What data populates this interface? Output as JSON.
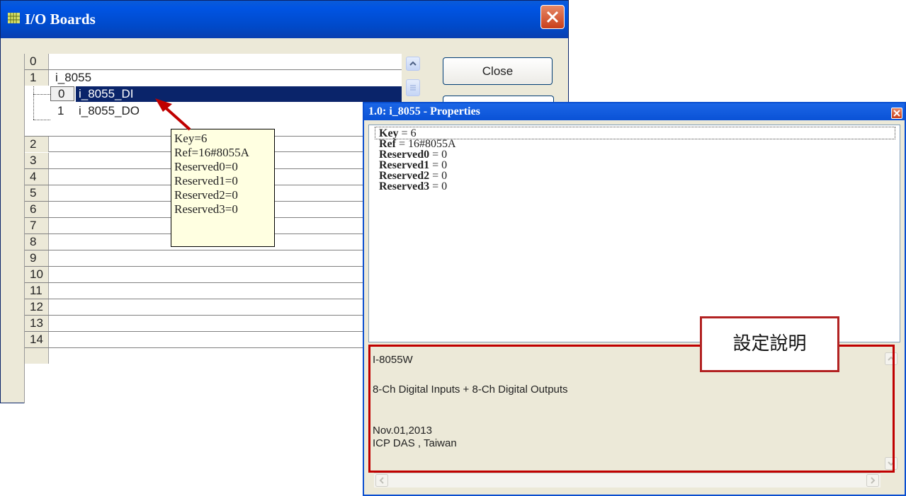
{
  "io_window": {
    "title": "I/O Boards",
    "close_button_label": "Close",
    "slots": [
      {
        "num": "0",
        "name": ""
      },
      {
        "num": "1",
        "name": "i_8055"
      },
      {
        "num": "2",
        "name": ""
      },
      {
        "num": "3",
        "name": ""
      },
      {
        "num": "4",
        "name": ""
      },
      {
        "num": "5",
        "name": ""
      },
      {
        "num": "6",
        "name": ""
      },
      {
        "num": "7",
        "name": ""
      },
      {
        "num": "8",
        "name": ""
      },
      {
        "num": "9",
        "name": ""
      },
      {
        "num": "10",
        "name": ""
      },
      {
        "num": "11",
        "name": ""
      },
      {
        "num": "12",
        "name": ""
      },
      {
        "num": "13",
        "name": ""
      },
      {
        "num": "14",
        "name": ""
      }
    ],
    "sub_items": [
      {
        "num": "0",
        "name": "i_8055_DI",
        "selected": true
      },
      {
        "num": "1",
        "name": "i_8055_DO",
        "selected": false
      }
    ],
    "tooltip": [
      "Key=6",
      "Ref=16#8055A",
      "Reserved0=0",
      "Reserved1=0",
      "Reserved2=0",
      "Reserved3=0"
    ]
  },
  "properties_window": {
    "title": "1.0: i_8055 - Properties",
    "properties": [
      {
        "key": "Key",
        "value": " = 6"
      },
      {
        "key": "Ref",
        "value": " = 16#8055A"
      },
      {
        "key": "Reserved0",
        "value": " = 0"
      },
      {
        "key": "Reserved1",
        "value": " = 0"
      },
      {
        "key": "Reserved2",
        "value": " = 0"
      },
      {
        "key": "Reserved3",
        "value": " = 0"
      }
    ],
    "description": {
      "model": "I-8055W",
      "summary": "8-Ch Digital Inputs + 8-Ch Digital Outputs",
      "date": "Nov.01,2013",
      "vendor": "ICP DAS , Taiwan"
    }
  },
  "annotation": {
    "label": "設定說明",
    "color": "#c00000"
  }
}
